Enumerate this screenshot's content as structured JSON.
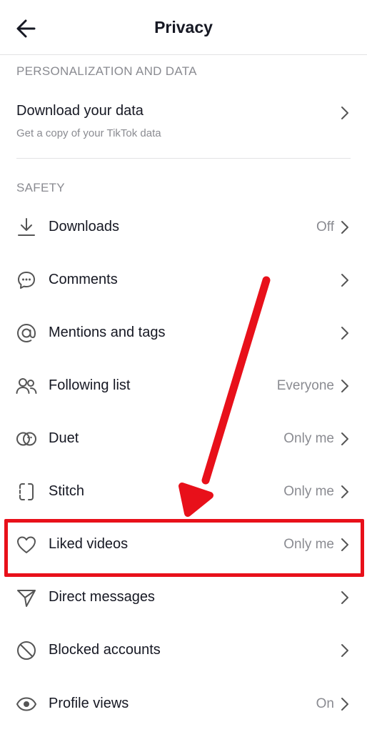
{
  "header": {
    "title": "Privacy"
  },
  "sections": {
    "personalization": "PERSONALIZATION AND DATA",
    "safety": "SAFETY"
  },
  "download_data": {
    "title": "Download your data",
    "subtitle": "Get a copy of your TikTok data"
  },
  "rows": [
    {
      "label": "Downloads",
      "value": "Off",
      "icon": "download-icon"
    },
    {
      "label": "Comments",
      "value": "",
      "icon": "comment-icon"
    },
    {
      "label": "Mentions and tags",
      "value": "",
      "icon": "at-sign-icon"
    },
    {
      "label": "Following list",
      "value": "Everyone",
      "icon": "people-icon"
    },
    {
      "label": "Duet",
      "value": "Only me",
      "icon": "duet-icon"
    },
    {
      "label": "Stitch",
      "value": "Only me",
      "icon": "stitch-icon"
    },
    {
      "label": "Liked videos",
      "value": "Only me",
      "icon": "heart-icon"
    },
    {
      "label": "Direct messages",
      "value": "",
      "icon": "send-icon"
    },
    {
      "label": "Blocked accounts",
      "value": "",
      "icon": "block-icon"
    },
    {
      "label": "Profile views",
      "value": "On",
      "icon": "eye-icon"
    }
  ],
  "colors": {
    "annotation": "#e8101a",
    "secondary_text": "#8a8b91",
    "primary_text": "#161823"
  }
}
